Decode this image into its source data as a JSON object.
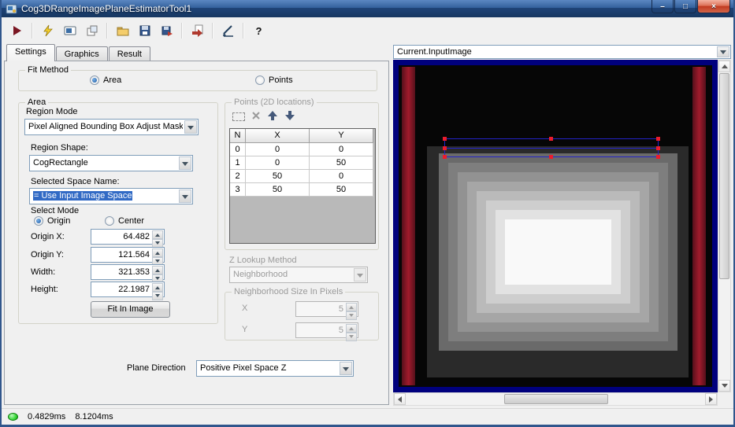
{
  "window": {
    "title": "Cog3DRangeImagePlaneEstimatorTool1",
    "minimize_glyph": "–",
    "maximize_glyph": "□",
    "close_glyph": "×"
  },
  "toolbar": {
    "icon_names": [
      "run-icon",
      "electric-run-icon",
      "display-button-icon",
      "new-tool-icon",
      "open-folder-icon",
      "save-icon",
      "save-results-icon",
      "import-icon",
      "signature-icon",
      "help-icon"
    ],
    "help_glyph": "?"
  },
  "tabs": [
    {
      "label": "Settings",
      "active": true
    },
    {
      "label": "Graphics",
      "active": false
    },
    {
      "label": "Result",
      "active": false
    }
  ],
  "settings": {
    "fit_method": {
      "label": "Fit Method",
      "options": [
        {
          "label": "Area",
          "selected": true
        },
        {
          "label": "Points",
          "selected": false
        }
      ]
    },
    "area": {
      "label": "Area",
      "region_mode_label": "Region Mode",
      "region_mode_value": "Pixel Aligned Bounding Box Adjust Mask",
      "region_shape_label": "Region Shape:",
      "region_shape_value": "CogRectangle",
      "space_name_label": "Selected Space Name:",
      "space_name_value": "= Use Input Image Space",
      "select_mode_label": "Select Mode",
      "select_mode_options": [
        {
          "label": "Origin",
          "selected": true
        },
        {
          "label": "Center",
          "selected": false
        }
      ],
      "fields": [
        {
          "label": "Origin X:",
          "value": "64.482"
        },
        {
          "label": "Origin Y:",
          "value": "121.564"
        },
        {
          "label": "Width:",
          "value": "321.353"
        },
        {
          "label": "Height:",
          "value": "22.1987"
        }
      ],
      "fit_button_label": "Fit In Image"
    },
    "points": {
      "label": "Points (2D locations)",
      "table": {
        "headers": [
          "N",
          "X",
          "Y"
        ],
        "rows": [
          [
            "0",
            "0",
            "0"
          ],
          [
            "1",
            "0",
            "50"
          ],
          [
            "2",
            "50",
            "0"
          ],
          [
            "3",
            "50",
            "50"
          ]
        ]
      },
      "z_lookup_label": "Z Lookup Method",
      "z_lookup_value": "Neighborhood",
      "neighborhood": {
        "label": "Neighborhood Size In Pixels",
        "x_label": "X",
        "x_value": "5",
        "y_label": "Y",
        "y_value": "5"
      }
    },
    "plane_direction_label": "Plane Direction",
    "plane_direction_value": "Positive Pixel Space Z"
  },
  "image_panel": {
    "source_value": "Current.InputImage"
  },
  "status_bar": {
    "time1": "0.4829ms",
    "time2": "8.1204ms"
  },
  "colors": {
    "selection_blue": "#316ac5",
    "overlay_blue": "#2323c8",
    "handle_red": "#ea1c2d",
    "canvas_border_navy": "#00007d",
    "bar_red": "#8c1626",
    "led_green": "#2fbf2f"
  }
}
